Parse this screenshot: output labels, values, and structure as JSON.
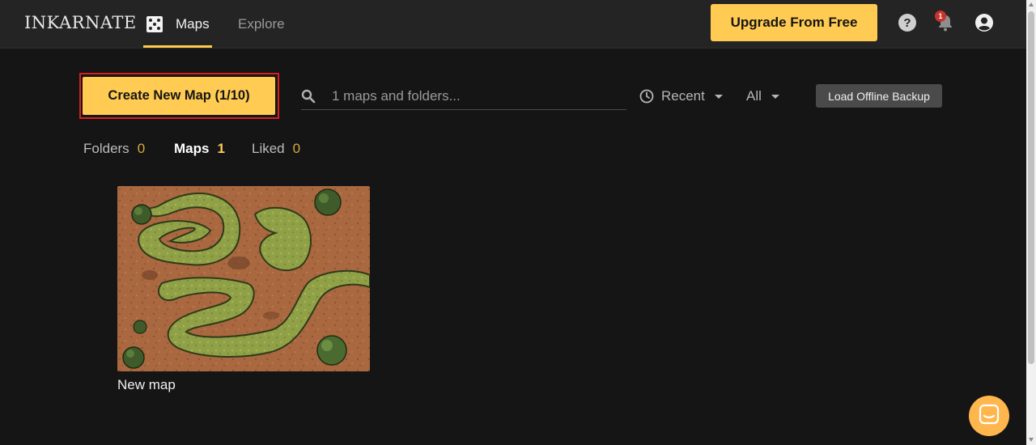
{
  "app": {
    "logo_text": "INKARNATE"
  },
  "nav": {
    "maps_label": "Maps",
    "explore_label": "Explore"
  },
  "header": {
    "upgrade_label": "Upgrade From Free",
    "notification_count": "1"
  },
  "toolbar": {
    "create_label": "Create New Map (1/10)",
    "search_placeholder": "1 maps and folders...",
    "sort_label": "Recent",
    "filter_label": "All",
    "backup_label": "Load Offline Backup"
  },
  "tabs": [
    {
      "label": "Folders",
      "count": "0"
    },
    {
      "label": "Maps",
      "count": "1"
    },
    {
      "label": "Liked",
      "count": "0"
    }
  ],
  "maps": [
    {
      "title": "New map"
    }
  ],
  "colors": {
    "accent": "#ffcb52",
    "background": "#151515",
    "topbar": "#242424",
    "highlight_border": "#d62020",
    "badge": "#c8342c"
  },
  "icons": {
    "nav_maps": "dice-map-icon",
    "help": "help-circle-icon",
    "notifications": "bell-icon",
    "account": "account-circle-icon",
    "search": "search-icon",
    "sort": "clock-icon",
    "chat": "chat-icon"
  }
}
